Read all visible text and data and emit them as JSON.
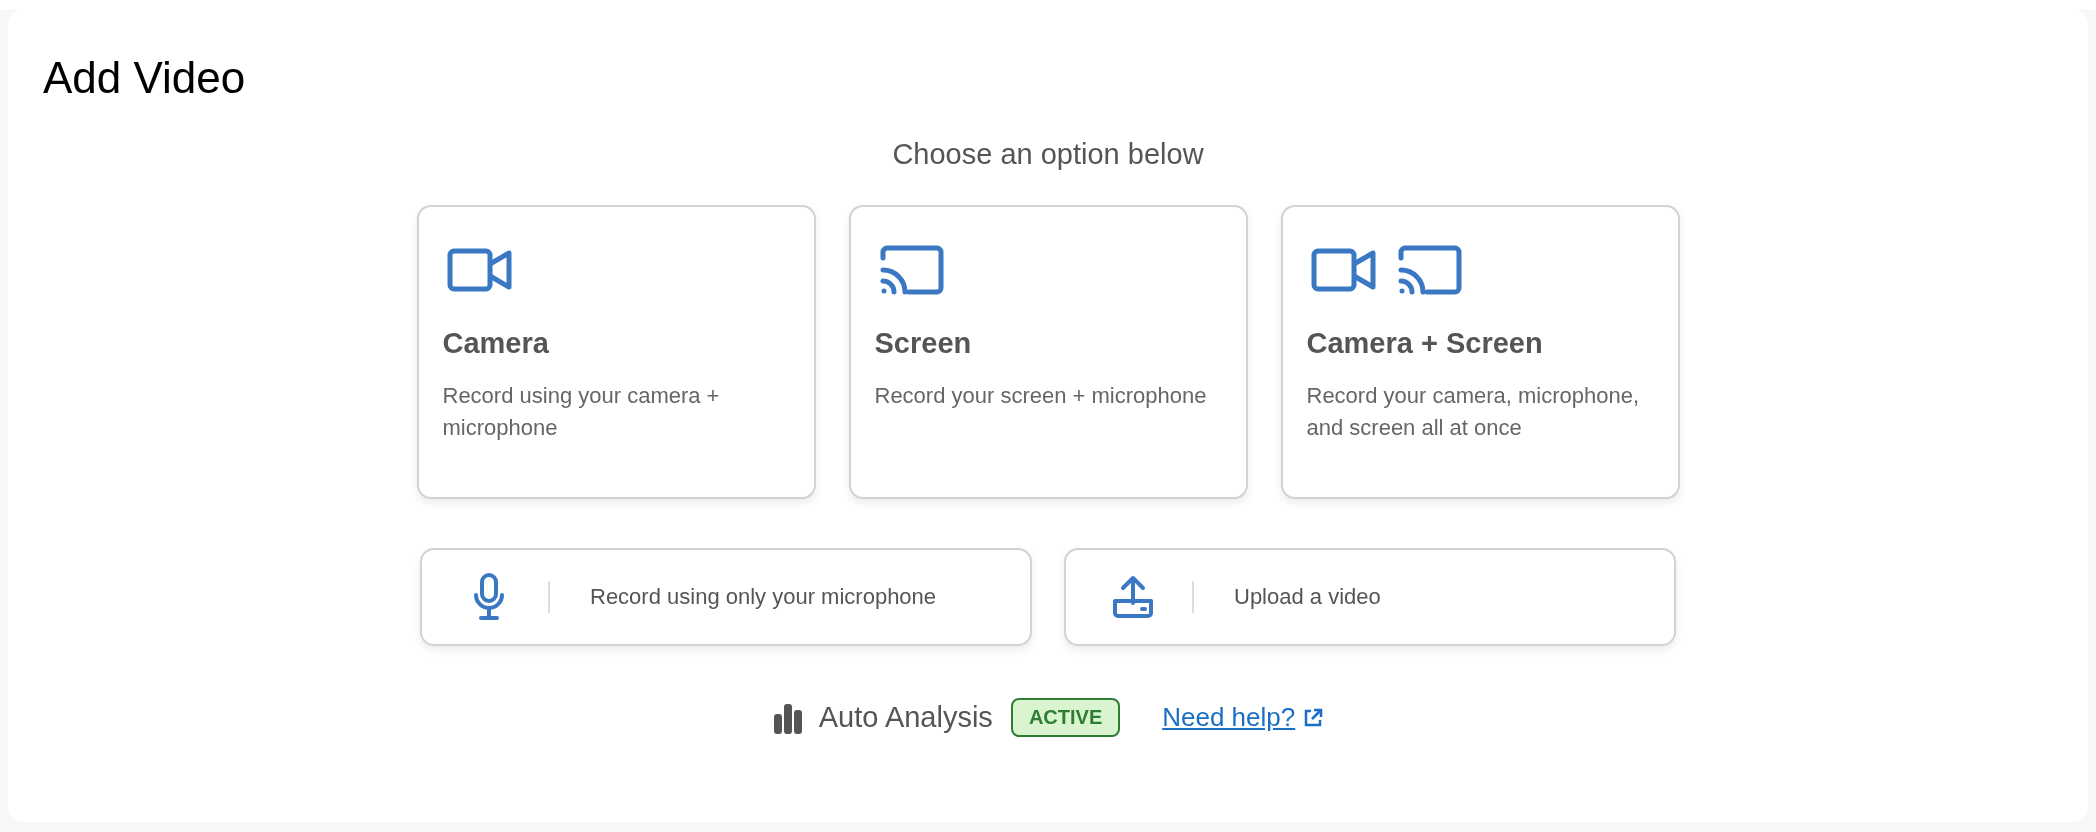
{
  "title": "Add Video",
  "prompt": "Choose an option below",
  "options": [
    {
      "kind": "camera",
      "title": "Camera",
      "description": "Record using your camera + microphone"
    },
    {
      "kind": "screen",
      "title": "Screen",
      "description": "Record your screen + microphone"
    },
    {
      "kind": "camera_screen",
      "title": "Camera + Screen",
      "description": "Record your camera, microphone, and screen all at once"
    }
  ],
  "actions": [
    {
      "kind": "microphone",
      "label": "Record using only your microphone"
    },
    {
      "kind": "upload",
      "label": "Upload a video"
    }
  ],
  "footer": {
    "label": "Auto Analysis",
    "badge": "ACTIVE",
    "link": "Need help?"
  }
}
